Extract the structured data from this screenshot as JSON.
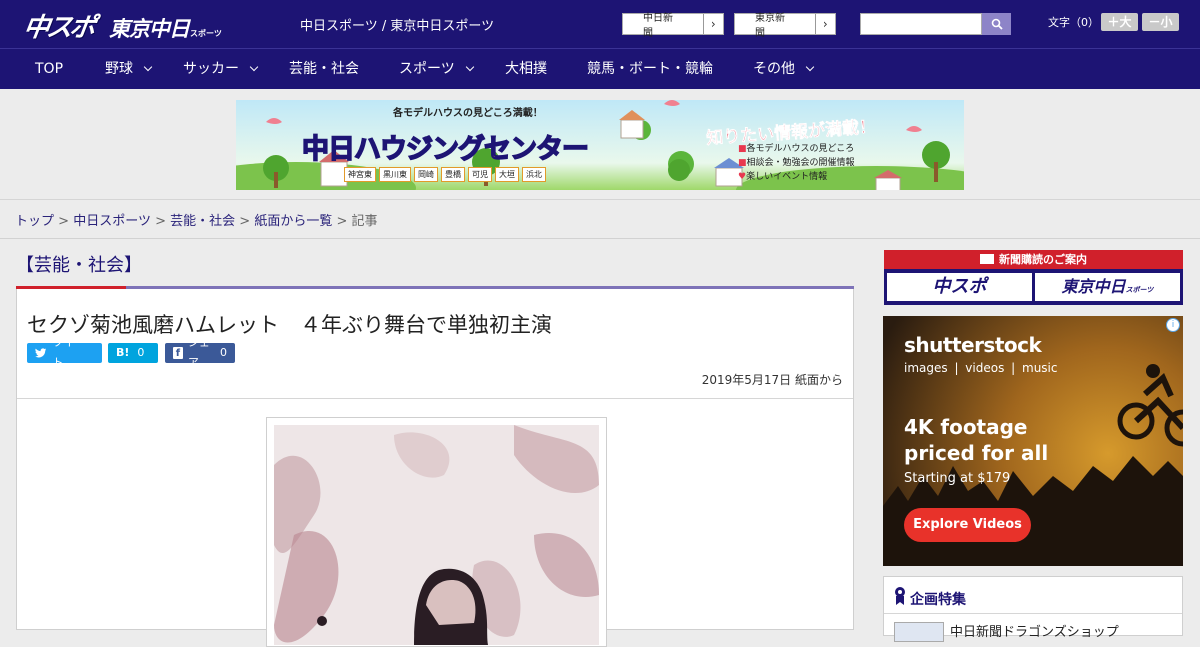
{
  "header": {
    "logo_main": "中スポ",
    "logo_tokyo": "東京中日",
    "logo_small": "スポーツ",
    "site_title": "中日スポーツ / 東京中日スポーツ",
    "paper_links": [
      {
        "label": "中日新聞",
        "arrow": "›"
      },
      {
        "label": "東京新聞",
        "arrow": "›"
      }
    ],
    "search_placeholder": "",
    "fontsize_label": "文字（0）",
    "fontsize_larger": "＋大",
    "fontsize_smaller": "－小"
  },
  "nav": [
    {
      "label": "TOP",
      "dropdown": false
    },
    {
      "label": "野球",
      "dropdown": true
    },
    {
      "label": "サッカー",
      "dropdown": true
    },
    {
      "label": "芸能・社会",
      "dropdown": false
    },
    {
      "label": "スポーツ",
      "dropdown": true
    },
    {
      "label": "大相撲",
      "dropdown": false
    },
    {
      "label": "競馬・ボート・競輪",
      "dropdown": false
    },
    {
      "label": "その他",
      "dropdown": true
    }
  ],
  "banner": {
    "top_text": "各モデルハウスの見どころ満載！",
    "main_text": "中日ハウジングセンター",
    "right_heading": "知りたい情報が満載！",
    "right_items": [
      "各モデルハウスの見どころ",
      "相談会・勉強会の開催情報",
      "楽しいイベント情報"
    ],
    "locations": [
      "神宮東",
      "黒川東",
      "岡崎",
      "豊橋",
      "可児",
      "大垣",
      "浜北"
    ]
  },
  "breadcrumb": {
    "items": [
      "トップ",
      "中日スポーツ",
      "芸能・社会",
      "紙面から一覧"
    ],
    "current": "記事",
    "separator": ">"
  },
  "article": {
    "category": "【芸能・社会】",
    "headline": "セクゾ菊池風磨ハムレット　４年ぶり舞台で単独初主演",
    "share": [
      {
        "label": "ツイート",
        "count": ""
      },
      {
        "label": "B!",
        "count": "0"
      },
      {
        "label": "シェア",
        "count": "0"
      }
    ],
    "date": "2019年5月17日 紙面から"
  },
  "sidebar": {
    "subscribe_title": "新聞購読のご案内",
    "subscribe_logos": [
      "中スポ",
      "東京中日"
    ],
    "subscribe_logo_small": "スポーツ",
    "ad": {
      "brand": "shutterstock",
      "sub": "images  |  videos  |  music",
      "headline": "4K footage priced for all",
      "price": "Starting at $179",
      "cta": "Explore Videos",
      "info": "i"
    },
    "feature_title": "企画特集",
    "feature_item": "中日新聞ドラゴンズショップ"
  },
  "colors": {
    "navy": "#1d1474",
    "red": "#d0202b",
    "twitter": "#1da1f2",
    "hatena": "#00a4de",
    "facebook": "#3b5998"
  }
}
